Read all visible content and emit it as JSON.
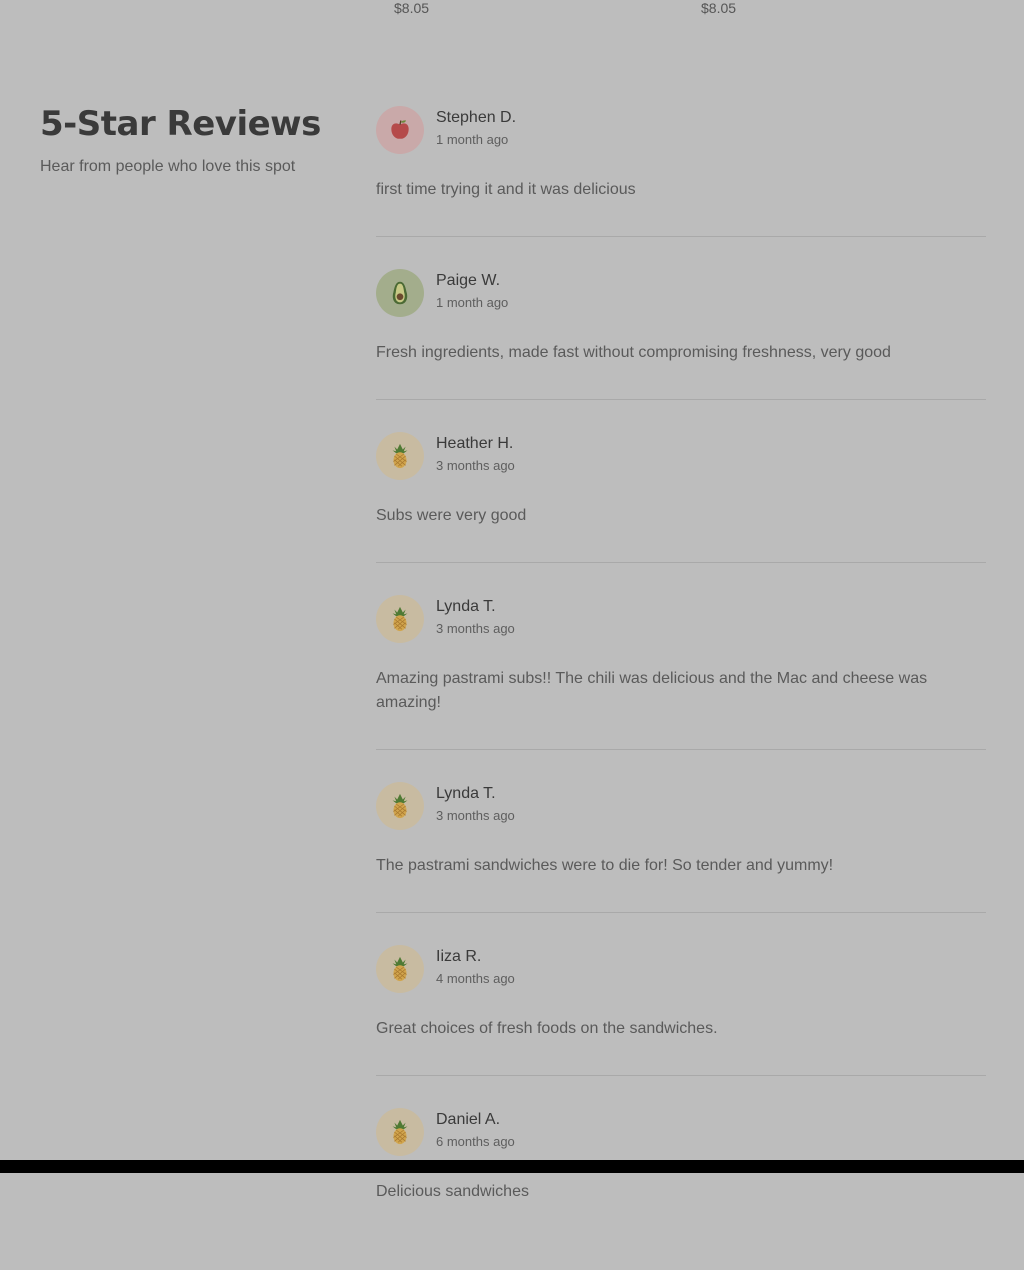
{
  "top_prices": [
    "$8.05",
    "$8.05"
  ],
  "section": {
    "title": "5-Star Reviews",
    "subtitle": "Hear from people who love this spot"
  },
  "reviews": [
    {
      "name": "Stephen D.",
      "time": "1 month ago",
      "text": "first time trying it and it was delicious",
      "avatar": "apple-icon"
    },
    {
      "name": "Paige W.",
      "time": "1 month ago",
      "text": "Fresh ingredients, made fast without compromising freshness, very good",
      "avatar": "avocado-icon"
    },
    {
      "name": "Heather H.",
      "time": "3 months ago",
      "text": "Subs were very good",
      "avatar": "pineapple-icon"
    },
    {
      "name": "Lynda T.",
      "time": "3 months ago",
      "text": "Amazing pastrami subs!! The chili was delicious and the Mac and cheese was amazing!",
      "avatar": "pineapple-icon"
    },
    {
      "name": "Lynda T.",
      "time": "3 months ago",
      "text": "The pastrami sandwiches were to die for! So tender and yummy!",
      "avatar": "pineapple-icon"
    },
    {
      "name": "Iiza R.",
      "time": "4 months ago",
      "text": "Great choices of fresh foods on the sandwiches.",
      "avatar": "pineapple-icon"
    },
    {
      "name": "Daniel A.",
      "time": "6 months ago",
      "text": "Delicious sandwiches",
      "avatar": "pineapple-icon"
    }
  ],
  "colors": {
    "overlay_background": "#bdbdbd",
    "divider": "#a9a9a9",
    "apple_avatar_bg": "#c9a9a9",
    "avocado_avatar_bg": "#a3ad8c",
    "pineapple_avatar_bg": "#c8bba1"
  }
}
